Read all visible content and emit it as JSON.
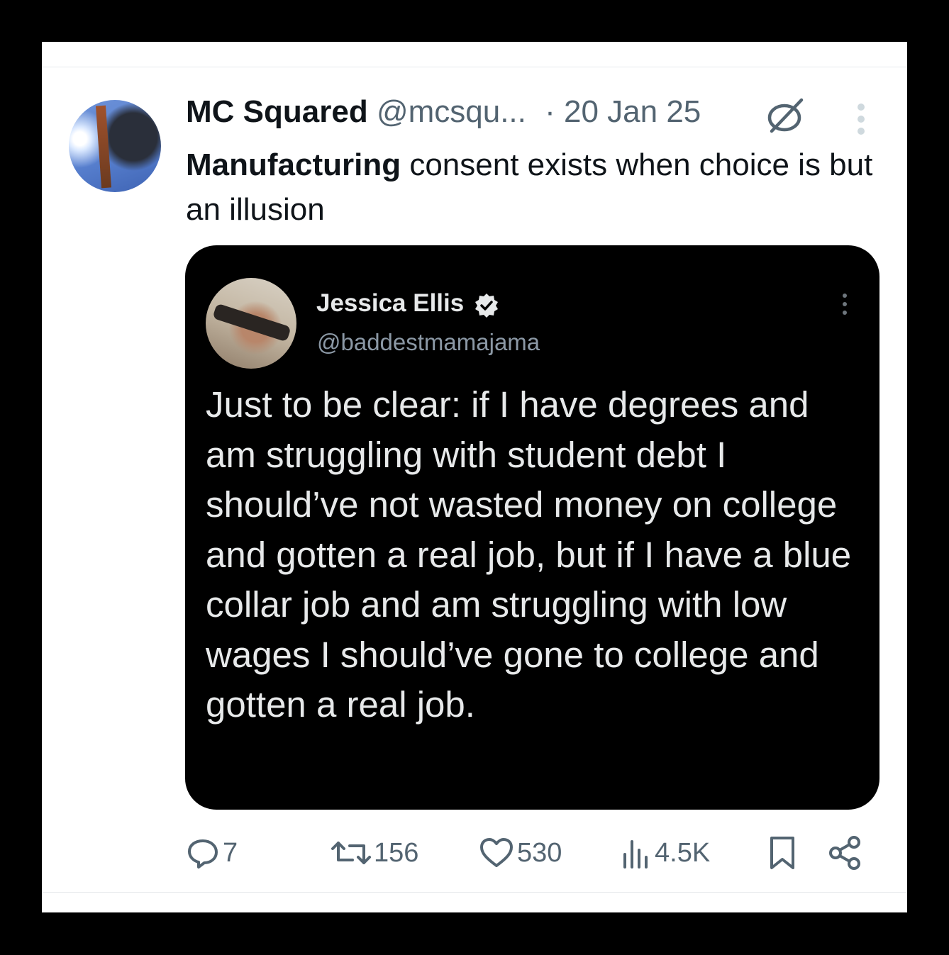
{
  "tweet": {
    "author_name": "MC Squared",
    "author_handle": "@mcsqu...",
    "date": "· 20 Jan 25",
    "text_bold": "Manufacturing",
    "text_rest": " consent exists when choice is but an illusion",
    "icons": {
      "avatar": "avatar-image",
      "automated": "robot-slash-icon",
      "more": "more-vertical-icon"
    }
  },
  "quoted": {
    "name": "Jessica Ellis",
    "handle": "@baddestmamajama",
    "text": "Just to be clear: if I have degrees and am struggling with student debt I should’ve not wasted money on college and gotten a real job, but if I have a blue collar job and am struggling with low wages I should’ve gone to college and gotten a real job.",
    "icons": {
      "verified": "verified-badge-icon",
      "more": "more-vertical-icon"
    }
  },
  "actions": {
    "replies": "7",
    "reposts": "156",
    "likes": "530",
    "views": "4.5K",
    "icons": [
      "reply-icon",
      "repost-icon",
      "like-icon",
      "views-icon",
      "bookmark-icon",
      "share-icon"
    ]
  },
  "colors": {
    "text": "#0f1419",
    "muted": "#536471",
    "quote_bg": "#000000",
    "quote_text": "#e7e9ea"
  }
}
